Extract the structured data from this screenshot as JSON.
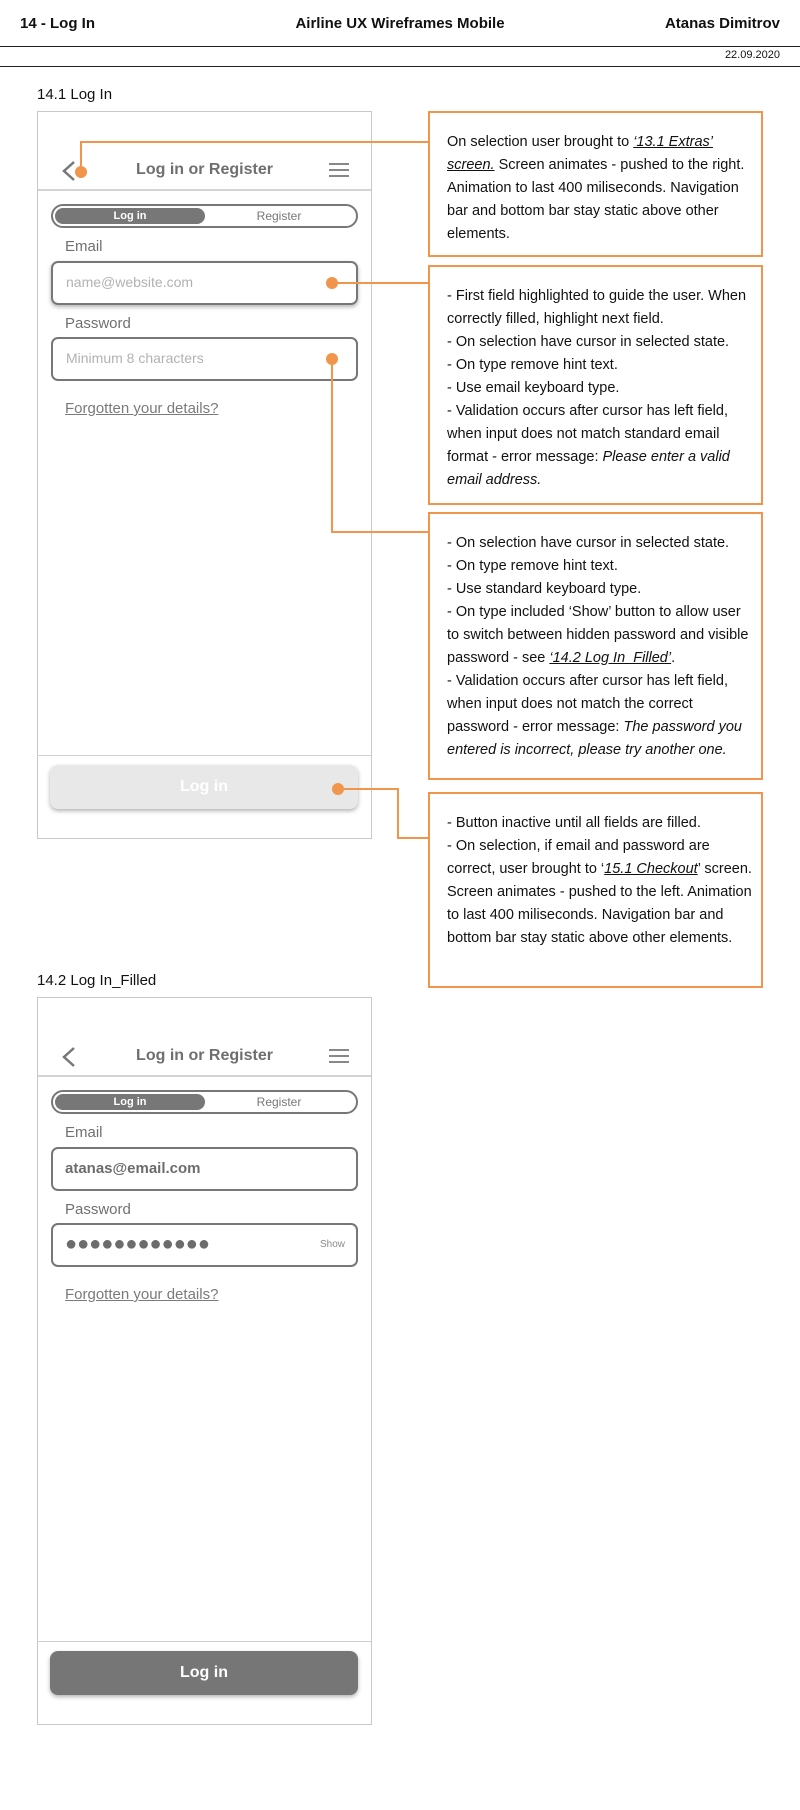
{
  "header": {
    "left": "14 - Log In",
    "center": "Airline UX Wireframes Mobile",
    "right": "Atanas Dimitrov",
    "date": "22.09.2020"
  },
  "accent_color": "#f0954b",
  "screens": [
    {
      "title": "14.1 Log In",
      "nav_title": "Log in or Register",
      "tab_active": "Log in",
      "tab_inactive": "Register",
      "email_label": "Email",
      "email_placeholder": "name@website.com",
      "password_label": "Password",
      "password_placeholder": "Minimum 8 characters",
      "forgot": "Forgotten your details?",
      "button": "Log in",
      "button_state": "inactive"
    },
    {
      "title": "14.2 Log In_Filled",
      "nav_title": "Log in or Register",
      "tab_active": "Log in",
      "tab_inactive": "Register",
      "email_label": "Email",
      "email_value": "atanas@email.com",
      "password_label": "Password",
      "password_mask": "●●●●●●●●●●●●",
      "show_label": "Show",
      "forgot": "Forgotten your details?",
      "button": "Log in",
      "button_state": "active"
    }
  ],
  "annotations": {
    "a1": {
      "t1": "On selection user brought to ",
      "link": "‘13.1 Extras’ screen.",
      "t2": " Screen animates - pushed to the right. Animation to last 400 miliseconds. Navigation bar and bottom bar stay static above other elements."
    },
    "a2": {
      "l1": "- First field highlighted to guide the user. When correctly filled, highlight next field.",
      "l2": "- On selection have cursor in selected state.",
      "l3": "- On type remove hint text.",
      "l4": "- Use email keyboard type.",
      "l5a": "- Validation occurs after cursor has left field, when input does not match standard email format - error message: ",
      "l5b": "Please enter a valid email address."
    },
    "a3": {
      "l1": "- On selection have cursor in selected state.",
      "l2": "- On type remove hint text.",
      "l3": "- Use standard keyboard type.",
      "l4a": "- On type included ‘Show’ button to allow user to switch between hidden password and visible password - see ",
      "l4link": "‘14.2 Log In_Filled’",
      "l4b": ".",
      "l5a": "- Validation occurs after cursor has left field, when input does not match the correct password - error message: ",
      "l5b": "The password you entered is incorrect, please try another one."
    },
    "a4": {
      "l1": "- Button inactive until all fields are filled.",
      "l2a": "- On selection, if email and password are correct, user brought to ‘",
      "l2link": "15.1 Checkout",
      "l2b": "’ screen. Screen animates - pushed to the left. Animation to last 400 miliseconds. Navigation bar and bottom bar stay static above other elements."
    }
  }
}
